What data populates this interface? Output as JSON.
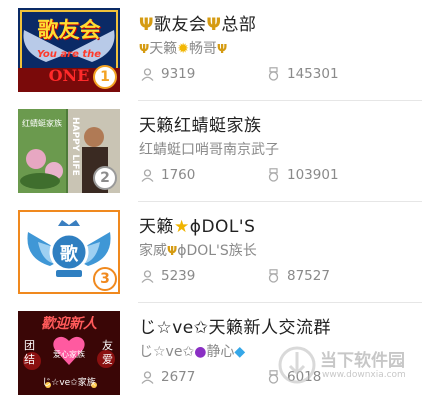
{
  "groups": [
    {
      "title": {
        "prefix": "Ψ",
        "name": "歌友会",
        "mid": "Ψ",
        "suffix": "总部"
      },
      "subtitle": {
        "a": "Ψ",
        "b": "天籁",
        "c": "✹",
        "d": "畅哥",
        "e": "Ψ"
      },
      "members": "9319",
      "score": "145301",
      "rank": "1",
      "thumb": {
        "line1": "歌友会",
        "line2": "You are the",
        "line3": "ONE"
      }
    },
    {
      "title": {
        "text": "天籁红蜻蜓家族"
      },
      "subtitle": {
        "text": "红蜻蜓口哨哥南京武子"
      },
      "members": "1760",
      "score": "103901",
      "rank": "2",
      "thumb": {
        "caption": "红蜻蜓家族",
        "vertical": "HAPPY LIFE"
      }
    },
    {
      "title": {
        "a": "天籁",
        "star": "★",
        "b": "ɸDOL'S"
      },
      "subtitle": {
        "a": "家威",
        "b": "Ψ",
        "c": "ɸDOL'S族长"
      },
      "members": "5239",
      "score": "87527",
      "rank": "3",
      "thumb": {
        "emblem": "歌"
      }
    },
    {
      "title": {
        "text": "じ☆ve✩天籁新人交流群"
      },
      "subtitle": {
        "a": "じ☆ve✩",
        "pearl": "●",
        "b": "静心",
        "gem": "◆"
      },
      "members": "2677",
      "score": "6018",
      "thumb": {
        "banner": "歡迎新人",
        "left": "团\n结",
        "right": "友\n爱",
        "center": "爱心家族",
        "bottom": "じ☆ve✩",
        "bottom2": "家族"
      }
    }
  ],
  "watermark": {
    "name": "当下软件园",
    "url": "www.downxia.com"
  }
}
